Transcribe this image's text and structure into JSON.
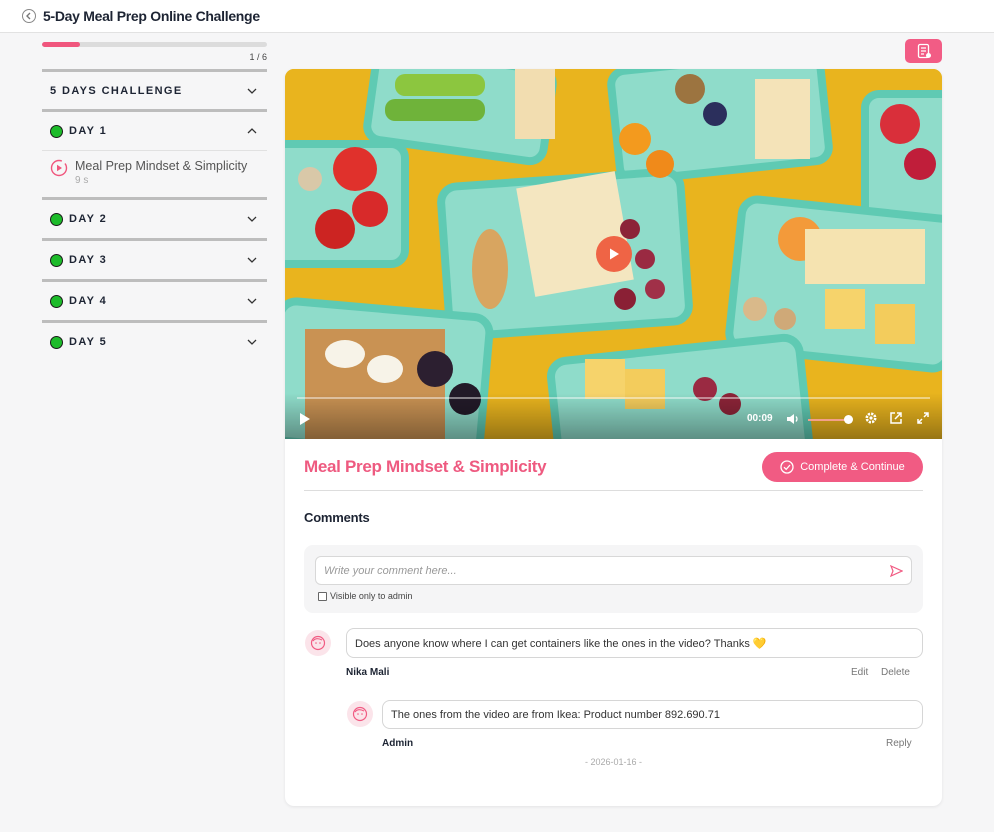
{
  "header": {
    "title": "5-Day Meal Prep Online Challenge"
  },
  "sidebar": {
    "progress": {
      "fraction": 0.167,
      "label": "1 / 6"
    },
    "section_title": "5 DAYS CHALLENGE",
    "days": [
      {
        "label": "DAY 1",
        "expanded": true,
        "lessons": [
          {
            "title": "Meal Prep Mindset & Simplicity",
            "duration": "9 s"
          }
        ]
      },
      {
        "label": "DAY 2",
        "expanded": false
      },
      {
        "label": "DAY 3",
        "expanded": false
      },
      {
        "label": "DAY 4",
        "expanded": false
      },
      {
        "label": "DAY 5",
        "expanded": false
      }
    ]
  },
  "video": {
    "time": "00:09",
    "volume": 0.85
  },
  "lesson": {
    "title": "Meal Prep Mindset & Simplicity",
    "complete_label": "Complete & Continue"
  },
  "comments": {
    "title": "Comments",
    "input_placeholder": "Write your comment here...",
    "visible_admin_label": "Visible only to admin",
    "items": [
      {
        "text": "Does anyone know where I can get containers like the ones in the video? Thanks 💛",
        "author": "Nika Mali",
        "actions": [
          "Edit",
          "Delete"
        ],
        "replies": [
          {
            "text": "The ones from the video are from Ikea: Product number 892.690.71",
            "author": "Admin",
            "action": "Reply"
          }
        ]
      }
    ],
    "date": "- 2026-01-16 -"
  },
  "colors": {
    "accent": "#f15b83",
    "progress": "#f0567d",
    "day_dot": "#1dbb2a"
  }
}
